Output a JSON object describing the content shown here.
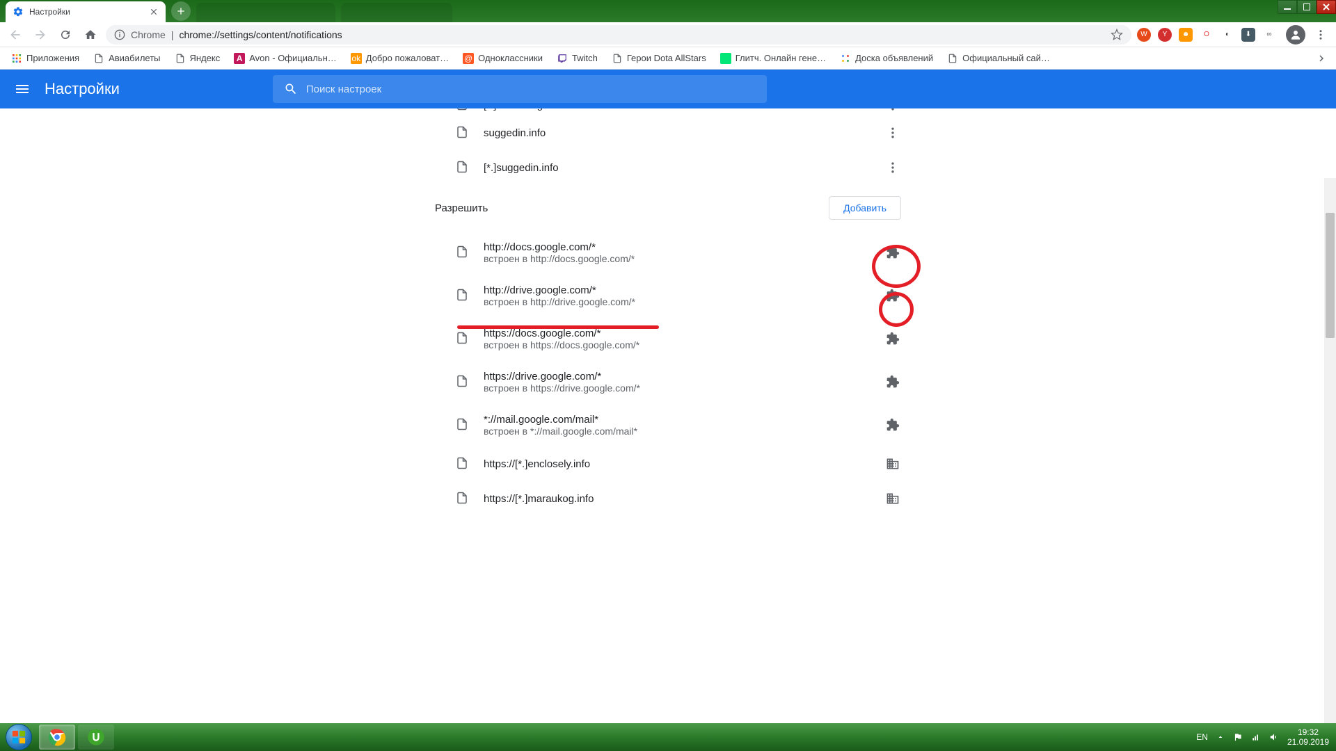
{
  "tab": {
    "title": "Настройки"
  },
  "address": {
    "proto": "Chrome",
    "path_pre": "chrome://",
    "path_bold": "settings",
    "path_rest": "/content/notifications"
  },
  "bookmarks": [
    {
      "label": "Приложения",
      "type": "apps"
    },
    {
      "label": "Авиабилеты",
      "type": "doc"
    },
    {
      "label": "Яндекс",
      "type": "doc"
    },
    {
      "label": "Avon - Официальн…",
      "type": "avon"
    },
    {
      "label": "Добро пожаловат…",
      "type": "ok"
    },
    {
      "label": "Одноклассники",
      "type": "mail"
    },
    {
      "label": "Twitch",
      "type": "twitch"
    },
    {
      "label": "Герои Dota AllStars",
      "type": "doc"
    },
    {
      "label": "Глитч. Онлайн гене…",
      "type": "glitch"
    },
    {
      "label": "Доска объявлений",
      "type": "dots"
    },
    {
      "label": "Официальный сай…",
      "type": "doc"
    }
  ],
  "settings": {
    "title": "Настройки",
    "search_placeholder": "Поиск настроек",
    "block_rows": [
      {
        "url": "[*.]maraukog.info"
      },
      {
        "url": "suggedin.info"
      },
      {
        "url": "[*.]suggedin.info"
      }
    ],
    "allow_title": "Разрешить",
    "add_label": "Добавить",
    "allow_rows": [
      {
        "url": "http://docs.google.com/*",
        "sub": "встроен в http://docs.google.com/*",
        "icon": "ext"
      },
      {
        "url": "http://drive.google.com/*",
        "sub": "встроен в http://drive.google.com/*",
        "icon": "ext"
      },
      {
        "url": "https://docs.google.com/*",
        "sub": "встроен в https://docs.google.com/*",
        "icon": "ext"
      },
      {
        "url": "https://drive.google.com/*",
        "sub": "встроен в https://drive.google.com/*",
        "icon": "ext"
      },
      {
        "url": "*://mail.google.com/mail*",
        "sub": "встроен в *://mail.google.com/mail*",
        "icon": "ext"
      },
      {
        "url": "https://[*.]enclosely.info",
        "sub": "",
        "icon": "org"
      },
      {
        "url": "https://[*.]maraukog.info",
        "sub": "",
        "icon": "org"
      }
    ]
  },
  "tray": {
    "lang": "EN",
    "time": "19:32",
    "date": "21.09.2019"
  }
}
